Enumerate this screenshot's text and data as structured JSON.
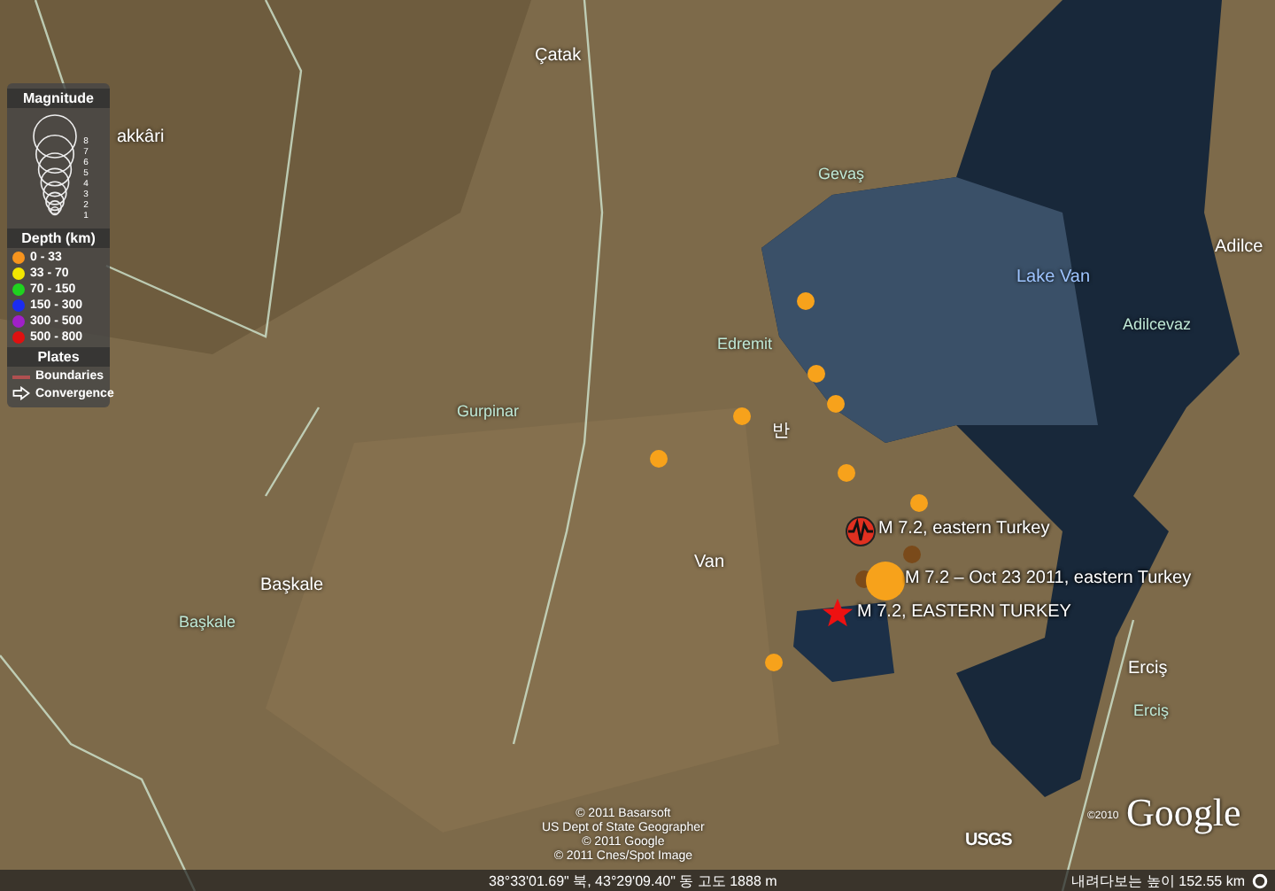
{
  "legend": {
    "magnitude_title": "Magnitude",
    "magnitude_scale": [
      "8",
      "7",
      "6",
      "5",
      "4",
      "3",
      "2",
      "1"
    ],
    "depth_title": "Depth (km)",
    "depth_classes": [
      {
        "label": "0 - 33",
        "color": "#f7941d"
      },
      {
        "label": "33 - 70",
        "color": "#f2e600"
      },
      {
        "label": "70 - 150",
        "color": "#1fd31f"
      },
      {
        "label": "150 - 300",
        "color": "#1b2cf0"
      },
      {
        "label": "300 - 500",
        "color": "#a020c8"
      },
      {
        "label": "500 - 800",
        "color": "#e01010"
      }
    ],
    "plates_title": "Plates",
    "plates": [
      {
        "kind": "boundary",
        "label": "Boundaries"
      },
      {
        "kind": "convergence",
        "label": "Convergence"
      }
    ]
  },
  "places": [
    {
      "kind": "town",
      "label": "Çatak"
    },
    {
      "kind": "town",
      "label": "akkâri"
    },
    {
      "kind": "district",
      "label": "Gevaş"
    },
    {
      "kind": "district",
      "label": "Edremit"
    },
    {
      "kind": "district",
      "label": "Gurpinar"
    },
    {
      "kind": "town",
      "label": "반"
    },
    {
      "kind": "town",
      "label": "Van"
    },
    {
      "kind": "lake",
      "label": "Lake Van"
    },
    {
      "kind": "district",
      "label": "Adilcevaz"
    },
    {
      "kind": "town",
      "label": "Adilce"
    },
    {
      "kind": "town",
      "label": "Başkale"
    },
    {
      "kind": "district",
      "label": "Başkale"
    },
    {
      "kind": "town",
      "label": "Erciş"
    },
    {
      "kind": "district",
      "label": "Erciş"
    }
  ],
  "events": [
    {
      "kind": "dot",
      "color": "#f7a21b"
    },
    {
      "kind": "dot",
      "color": "#f7a21b"
    },
    {
      "kind": "dot",
      "color": "#f7a21b"
    },
    {
      "kind": "dot",
      "color": "#f7a21b"
    },
    {
      "kind": "dot",
      "color": "#f7a21b"
    },
    {
      "kind": "dot",
      "color": "#f7a21b"
    },
    {
      "kind": "dot",
      "color": "#f7a21b"
    },
    {
      "kind": "dot",
      "color": "#f7a21b"
    },
    {
      "kind": "dot",
      "color": "#7a4a1a"
    },
    {
      "kind": "dot",
      "color": "#7a4a1a"
    },
    {
      "kind": "seismo",
      "color": "#e03020",
      "label": "M 7.2, eastern Turkey"
    },
    {
      "kind": "big",
      "color": "#f7a21b",
      "label": "M 7.2 – Oct 23 2011, eastern Turkey"
    },
    {
      "kind": "star",
      "color": "#ee1111",
      "label": "M 7.2, EASTERN TURKEY"
    }
  ],
  "attribution": [
    "© 2011 Basarsoft",
    "US Dept of State Geographer",
    "© 2011 Google",
    "© 2011 Cnes/Spot Image"
  ],
  "usgs_logo": "USGS",
  "google_copyright": "©2010",
  "google_logo": "Google",
  "status_bar": {
    "coordinates": "38°33'01.69\" 북, 43°29'09.40\" 동 고도 1888 m",
    "eye_altitude": "내려다보는 높이 152.55 km"
  }
}
